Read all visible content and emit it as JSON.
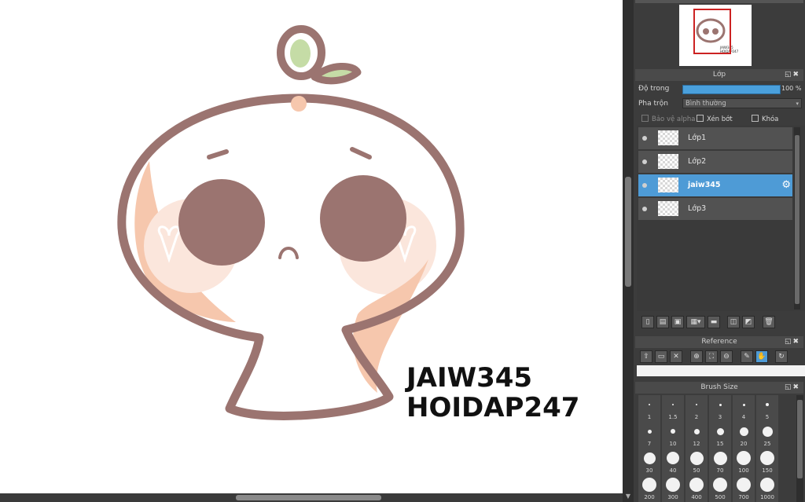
{
  "artwork": {
    "watermark_line1": "JAIW345",
    "watermark_line2": "HOIDAP247"
  },
  "navigator": {
    "thumb_caption_1": "JAIW345",
    "thumb_caption_2": "HOIDAP247"
  },
  "layers_panel": {
    "title": "Lớp",
    "opacity_label": "Độ trong",
    "opacity_value": "100 %",
    "opacity": 1.0,
    "blend_label": "Pha trộn",
    "blend_value": "Bình thường",
    "protect_alpha_label": "Bảo vệ alpha",
    "clipping_label": "Xén bớt",
    "lock_label": "Khóa",
    "layers": [
      {
        "name": "Lớp1",
        "selected": false
      },
      {
        "name": "Lớp2",
        "selected": false
      },
      {
        "name": "jaiw345",
        "selected": true
      },
      {
        "name": "Lớp3",
        "selected": false
      }
    ]
  },
  "reference_panel": {
    "title": "Reference"
  },
  "brush_size_panel": {
    "title": "Brush Size",
    "sizes": [
      "1",
      "1.5",
      "2",
      "3",
      "4",
      "5",
      "7",
      "10",
      "12",
      "15",
      "20",
      "25",
      "30",
      "40",
      "50",
      "70",
      "100",
      "150",
      "200",
      "300",
      "400",
      "500",
      "700",
      "1000"
    ]
  },
  "colors": {
    "accent": "#4e9bd6",
    "panel_bg": "#3c3c3c",
    "outline": "#9b7470",
    "blush": "#f6c7ad",
    "leaf": "#c5dca6"
  },
  "icons": {
    "layer_toolbar": [
      "new-layer-icon",
      "new-layer-alt-icon",
      "copy-layer-icon",
      "merge-down-icon",
      "folder-icon",
      "duplicate-icon",
      "mask-icon",
      "trash-icon"
    ],
    "reference_toolbar": [
      "upload-icon",
      "open-folder-icon",
      "close-icon",
      "zoom-in-icon",
      "fit-icon",
      "zoom-out-icon",
      "eyedropper-icon",
      "hand-icon",
      "rotate-icon"
    ]
  }
}
